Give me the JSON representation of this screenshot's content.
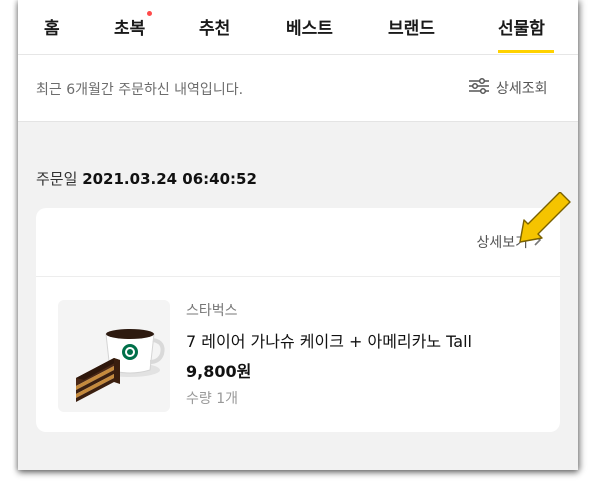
{
  "tabs": [
    {
      "label": "홈"
    },
    {
      "label": "초복",
      "has_new_dot": true
    },
    {
      "label": "추천"
    },
    {
      "label": "베스트"
    },
    {
      "label": "브랜드"
    },
    {
      "label": "선물함",
      "active": true
    }
  ],
  "notice": {
    "text": "최근 6개월간 주문하신 내역입니다.",
    "detail_search_label": "상세조회"
  },
  "order": {
    "date_label": "주문일",
    "date_value": "2021.03.24 06:40:52",
    "view_detail_label": "상세보기",
    "item": {
      "brand": "스타벅스",
      "name": "7 레이어 가나슈 케이크 + 아메리카노 Tall",
      "price": "9,800원",
      "quantity": "수량 1개"
    }
  },
  "colors": {
    "accent": "#ffd200",
    "new_dot": "#ff4a4a",
    "annotation_arrow": "#f5c400"
  },
  "icons": {
    "filter": "sliders-icon",
    "chevron": "chevron-right-icon",
    "annotation": "yellow-pointer-arrow"
  }
}
